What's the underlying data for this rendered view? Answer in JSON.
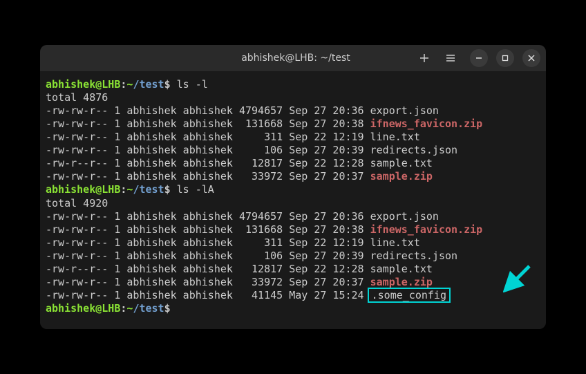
{
  "window": {
    "title": "abhishek@LHB: ~/test"
  },
  "prompt": {
    "user_host": "abhishek@LHB",
    "colon": ":",
    "path_tilde": "~",
    "path_dir": "/test",
    "dollar": "$"
  },
  "commands": {
    "cmd1": " ls -l",
    "cmd2": " ls -lA"
  },
  "output1": {
    "total": "total 4876",
    "rows": [
      {
        "perms": "-rw-rw-r--",
        "links": "1",
        "owner": "abhishek",
        "group": "abhishek",
        "size": "4794657",
        "date": "Sep 27 20:36",
        "name": "export.json",
        "zip": false
      },
      {
        "perms": "-rw-rw-r--",
        "links": "1",
        "owner": "abhishek",
        "group": "abhishek",
        "size": " 131668",
        "date": "Sep 27 20:38",
        "name": "ifnews_favicon.zip",
        "zip": true
      },
      {
        "perms": "-rw-rw-r--",
        "links": "1",
        "owner": "abhishek",
        "group": "abhishek",
        "size": "    311",
        "date": "Sep 22 12:19",
        "name": "line.txt",
        "zip": false
      },
      {
        "perms": "-rw-rw-r--",
        "links": "1",
        "owner": "abhishek",
        "group": "abhishek",
        "size": "    106",
        "date": "Sep 27 20:39",
        "name": "redirects.json",
        "zip": false
      },
      {
        "perms": "-rw-r--r--",
        "links": "1",
        "owner": "abhishek",
        "group": "abhishek",
        "size": "  12817",
        "date": "Sep 22 12:28",
        "name": "sample.txt",
        "zip": false
      },
      {
        "perms": "-rw-rw-r--",
        "links": "1",
        "owner": "abhishek",
        "group": "abhishek",
        "size": "  33972",
        "date": "Sep 27 20:37",
        "name": "sample.zip",
        "zip": true
      }
    ]
  },
  "output2": {
    "total": "total 4920",
    "rows": [
      {
        "perms": "-rw-rw-r--",
        "links": "1",
        "owner": "abhishek",
        "group": "abhishek",
        "size": "4794657",
        "date": "Sep 27 20:36",
        "name": "export.json",
        "zip": false,
        "hl": false
      },
      {
        "perms": "-rw-rw-r--",
        "links": "1",
        "owner": "abhishek",
        "group": "abhishek",
        "size": " 131668",
        "date": "Sep 27 20:38",
        "name": "ifnews_favicon.zip",
        "zip": true,
        "hl": false
      },
      {
        "perms": "-rw-rw-r--",
        "links": "1",
        "owner": "abhishek",
        "group": "abhishek",
        "size": "    311",
        "date": "Sep 22 12:19",
        "name": "line.txt",
        "zip": false,
        "hl": false
      },
      {
        "perms": "-rw-rw-r--",
        "links": "1",
        "owner": "abhishek",
        "group": "abhishek",
        "size": "    106",
        "date": "Sep 27 20:39",
        "name": "redirects.json",
        "zip": false,
        "hl": false
      },
      {
        "perms": "-rw-r--r--",
        "links": "1",
        "owner": "abhishek",
        "group": "abhishek",
        "size": "  12817",
        "date": "Sep 22 12:28",
        "name": "sample.txt",
        "zip": false,
        "hl": false
      },
      {
        "perms": "-rw-rw-r--",
        "links": "1",
        "owner": "abhishek",
        "group": "abhishek",
        "size": "  33972",
        "date": "Sep 27 20:37",
        "name": "sample.zip",
        "zip": true,
        "hl": false
      },
      {
        "perms": "-rw-rw-r--",
        "links": "1",
        "owner": "abhishek",
        "group": "abhishek",
        "size": "  41145",
        "date": "May 27 15:24",
        "name": ".some_config",
        "zip": false,
        "hl": true
      }
    ]
  },
  "colors": {
    "accent": "#00d4d4"
  }
}
